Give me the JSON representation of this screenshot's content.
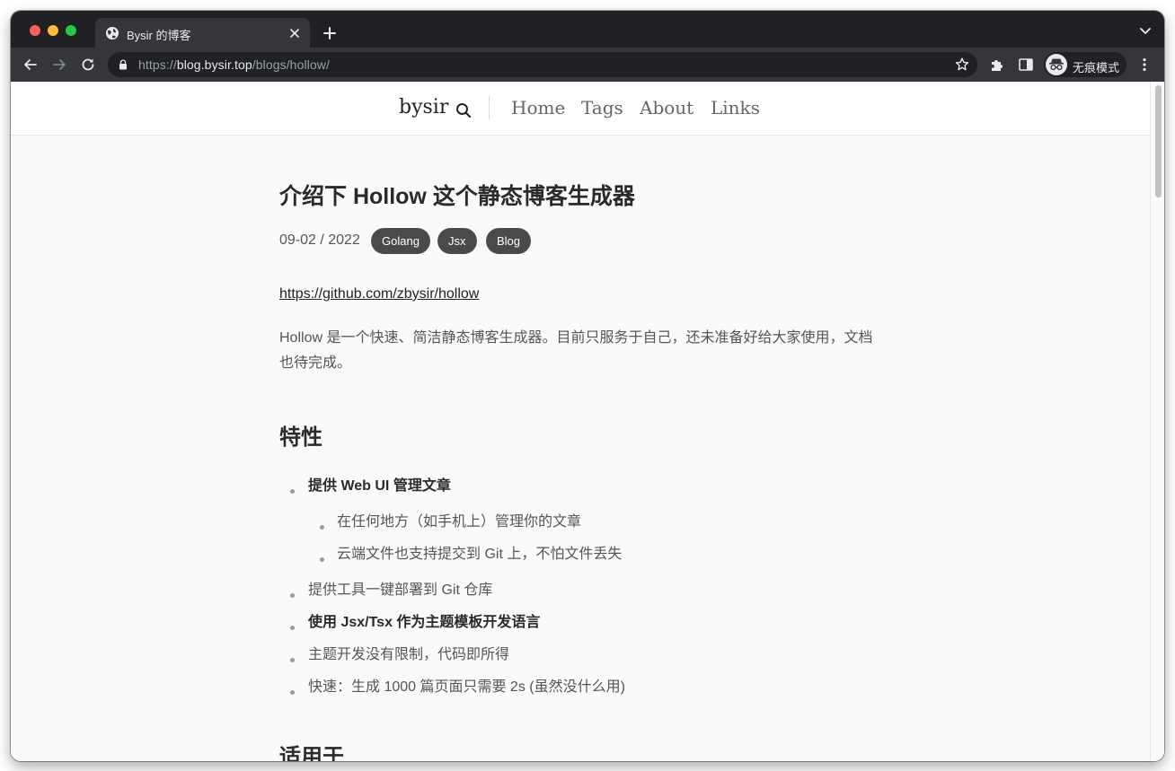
{
  "browser": {
    "tab_title": "Bysir 的博客",
    "url_scheme": "https://",
    "url_host": "blog.bysir.top",
    "url_path": "/blogs/hollow/",
    "incognito_label": "无痕模式",
    "icons": {
      "tab_favicon": "globe-icon",
      "close": "close-icon",
      "new_tab": "plus-icon",
      "tab_list": "chevron-down-icon",
      "back": "arrow-left-icon",
      "forward": "arrow-right-icon",
      "reload": "reload-icon",
      "lock": "lock-icon",
      "bookmark": "star-icon",
      "extensions": "puzzle-icon",
      "side_panel": "side-panel-icon",
      "incognito": "incognito-icon",
      "menu": "kebab-menu-icon"
    }
  },
  "site": {
    "brand": "bysir",
    "nav": [
      "Home",
      "Tags",
      "About",
      "Links"
    ]
  },
  "post": {
    "title": "介绍下 Hollow 这个静态博客生成器",
    "date": "09-02 / 2022",
    "tags": [
      "Golang",
      "Jsx",
      "Blog"
    ],
    "repo_link": "https://github.com/zbysir/hollow",
    "intro": "Hollow 是一个快速、简洁静态博客生成器。目前只服务于自己，还未准备好给大家使用，文档也待完成。",
    "section_features": "特性",
    "features": [
      "提供 Web UI 管理文章",
      "在任何地方（如手机上）管理你的文章",
      "云端文件也支持提交到 Git 上，不怕文件丢失",
      "提供工具一键部署到 Git 仓库",
      "使用 Jsx/Tsx 作为主题模板开发语言",
      "主题开发没有限制，代码即所得",
      "快速：生成 1000 篇页面只需要 2s (虽然没什么用)"
    ],
    "section_applicable": "适用于"
  }
}
